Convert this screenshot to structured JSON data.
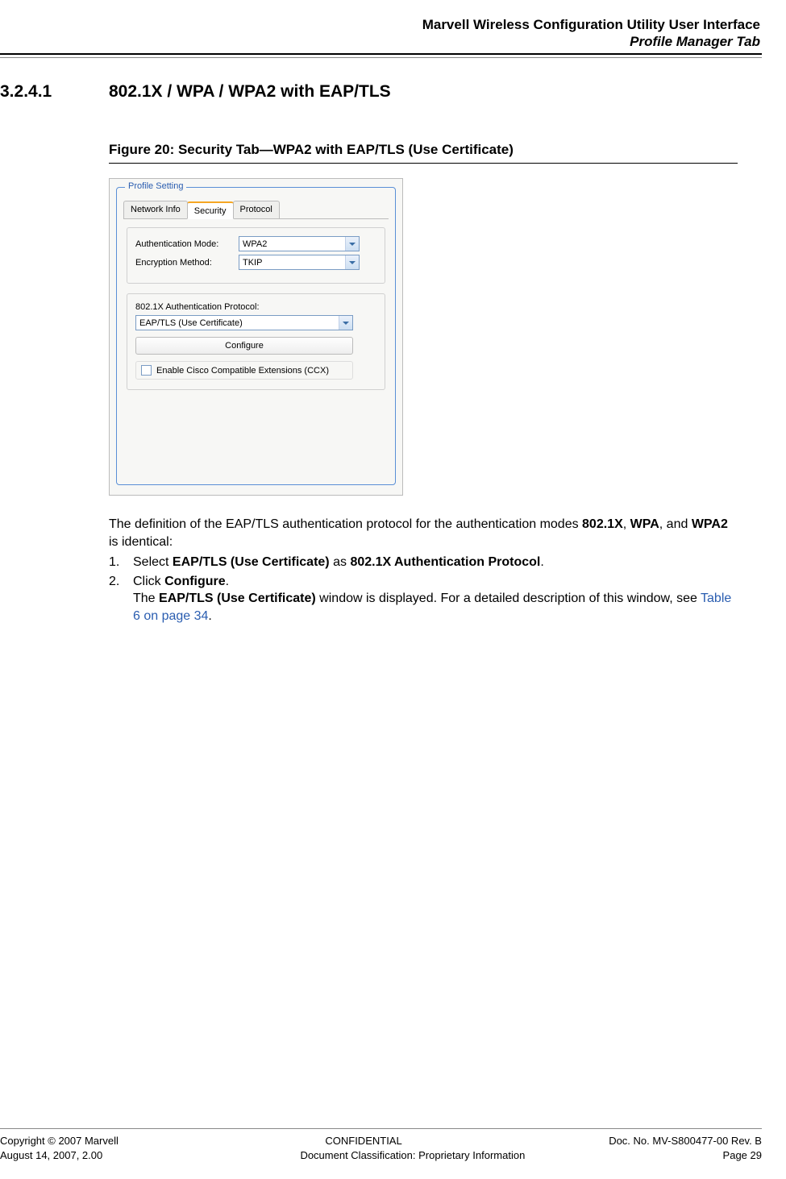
{
  "header": {
    "title": "Marvell Wireless Configuration Utility User Interface",
    "subtitle": "Profile Manager Tab"
  },
  "section": {
    "number": "3.2.4.1",
    "title": "802.1X / WPA / WPA2 with EAP/TLS"
  },
  "figure": {
    "caption": "Figure 20: Security Tab—WPA2 with EAP/TLS (Use Certificate)"
  },
  "screenshot": {
    "legend": "Profile Setting",
    "tabs": [
      "Network Info",
      "Security",
      "Protocol"
    ],
    "active_tab": 1,
    "auth_mode_label": "Authentication Mode:",
    "auth_mode_value": "WPA2",
    "enc_method_label": "Encryption Method:",
    "enc_method_value": "TKIP",
    "protocol_label": "802.1X Authentication Protocol:",
    "protocol_value": "EAP/TLS (Use Certificate)",
    "configure_btn": "Configure",
    "ccx_label": "Enable Cisco Compatible Extensions (CCX)"
  },
  "body": {
    "intro_pre": "The definition of the EAP/TLS authentication protocol for the authentication modes ",
    "b1": "802.1X",
    "intro_mid1": ", ",
    "b2": "WPA",
    "intro_mid2": ", and ",
    "b3": "WPA2",
    "intro_post": " is identical:",
    "step1_num": "1.",
    "step1_pre": "Select ",
    "step1_b1": "EAP/TLS (Use Certificate)",
    "step1_mid": " as ",
    "step1_b2": "802.1X Authentication Protocol",
    "step1_post": ".",
    "step2_num": "2.",
    "step2_pre": "Click ",
    "step2_b1": "Configure",
    "step2_post": ".",
    "step2_line2_pre": "The ",
    "step2_line2_b": "EAP/TLS (Use Certificate)",
    "step2_line2_mid": " window is displayed. For a detailed description of this window, see ",
    "step2_link": "Table 6 on page 34",
    "step2_line2_post": "."
  },
  "footer": {
    "copyright": "Copyright © 2007 Marvell",
    "confidential": "CONFIDENTIAL",
    "docno": "Doc. No. MV-S800477-00 Rev. B",
    "date": "August 14, 2007, 2.00",
    "classification": "Document Classification: Proprietary Information",
    "page": "Page 29"
  }
}
